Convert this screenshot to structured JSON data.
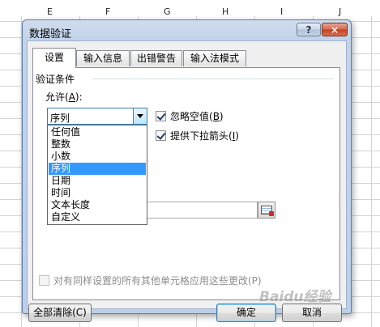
{
  "sheet": {
    "columns": [
      "E",
      "F",
      "G",
      "H",
      "I",
      "J"
    ]
  },
  "dialog": {
    "title": "数据验证",
    "help_glyph": "?",
    "close_glyph": "×",
    "tabs": [
      {
        "label": "设置",
        "active": true
      },
      {
        "label": "输入信息",
        "active": false
      },
      {
        "label": "出错警告",
        "active": false
      },
      {
        "label": "输入法模式",
        "active": false
      }
    ],
    "settings": {
      "group_label": "验证条件",
      "allow_label_pre": "允许(",
      "allow_label_key": "A",
      "allow_label_post": "):",
      "allow_value": "序列",
      "allow_options": [
        "任何值",
        "整数",
        "小数",
        "序列",
        "日期",
        "时间",
        "文本长度",
        "自定义"
      ],
      "selected_index": 3,
      "ignore_blank": {
        "label_pre": "忽略空值(",
        "key": "B",
        "label_post": ")",
        "checked": true
      },
      "in_cell_dropdown": {
        "label_pre": "提供下拉箭头(",
        "key": "I",
        "label_post": ")",
        "checked": true
      },
      "apply_all": {
        "label": "对有同样设置的所有其他单元格应用这些更改(P)",
        "checked": false,
        "enabled": false
      }
    },
    "buttons": {
      "clear_all": "全部清除(C)",
      "ok": "确定",
      "cancel": "取消"
    }
  },
  "watermark": "Baidu经验"
}
